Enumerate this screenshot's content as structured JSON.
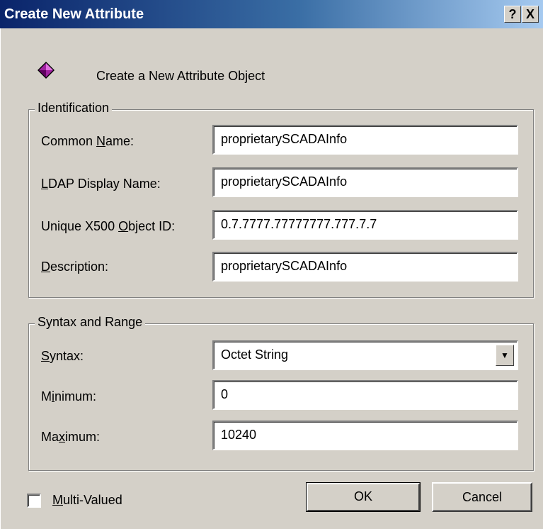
{
  "window": {
    "title": "Create New Attribute",
    "help_label": "?",
    "close_label": "X"
  },
  "header": {
    "icon": "purple-diamond-icon",
    "text": "Create a New Attribute Object"
  },
  "identification": {
    "legend": "Identification",
    "common_name": {
      "label_pre": "Common ",
      "label_mnemonic": "N",
      "label_post": "ame:",
      "value": "proprietarySCADAInfo"
    },
    "ldap_display_name": {
      "label_pre": "",
      "label_mnemonic": "L",
      "label_post": "DAP Display Name:",
      "value": "proprietarySCADAInfo"
    },
    "object_id": {
      "label_pre": "Unique X500 ",
      "label_mnemonic": "O",
      "label_post": "bject ID:",
      "value": "0.7.7777.77777777.777.7.7"
    },
    "description": {
      "label_pre": "",
      "label_mnemonic": "D",
      "label_post": "escription:",
      "value": "proprietarySCADAInfo"
    }
  },
  "syntax_range": {
    "legend": "Syntax and Range",
    "syntax": {
      "label_pre": "",
      "label_mnemonic": "S",
      "label_post": "yntax:",
      "value": "Octet String"
    },
    "minimum": {
      "label_pre": "M",
      "label_mnemonic": "i",
      "label_post": "nimum:",
      "value": "0"
    },
    "maximum": {
      "label_pre": "Ma",
      "label_mnemonic": "x",
      "label_post": "imum:",
      "value": "10240"
    }
  },
  "footer": {
    "multi_valued": {
      "label_pre": "",
      "label_mnemonic": "M",
      "label_post": "ulti-Valued",
      "checked": false
    },
    "ok_label": "OK",
    "cancel_label": "Cancel"
  }
}
